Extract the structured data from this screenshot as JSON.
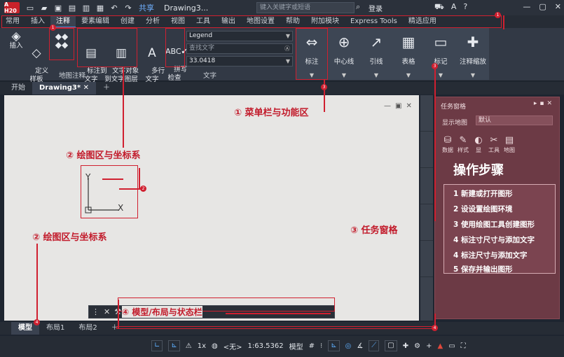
{
  "titlebar": {
    "logo": "A H20",
    "share": "共享",
    "doc_title": "Drawing3...",
    "search_placeholder": "键入关键字或短语",
    "login": "登录"
  },
  "menu_tabs": [
    "常用",
    "插入",
    "注释",
    "要素编辑",
    "创建",
    "分析",
    "视图",
    "工具",
    "输出",
    "地图设置",
    "帮助",
    "附加模块",
    "Express Tools",
    "精选应用"
  ],
  "active_menu_tab": "注释",
  "ribbon": {
    "insert_label": "插入",
    "define_label": "定义\n样板",
    "label_to_text": "标注到\n文字",
    "text_obj_label": "文字对象\n到文字图层",
    "map_annot_panel": "地图注释",
    "multiline_text": "多行\n文字",
    "spell_check": "拼写\n检查",
    "style_dropdown": "Legend",
    "find_text": "查找文字",
    "height_value": "33.0418",
    "text_panel": "文字",
    "dim_label": "标注",
    "centerline_label": "中心线",
    "leader_label": "引线",
    "table_label": "表格",
    "mark_label": "标记",
    "annot_scale_label": "注释缩放"
  },
  "doc_tabs": [
    "开始",
    "Drawing3*"
  ],
  "active_doc_tab": "Drawing3*",
  "canvas": {
    "axis_y": "Y",
    "axis_x": "X"
  },
  "task_pane": {
    "title": "任务窗格",
    "show_map_label": "显示地图",
    "show_map_value": "默认",
    "icons": [
      {
        "label": "数据",
        "icon": "database-icon"
      },
      {
        "label": "样式",
        "icon": "brush-icon"
      },
      {
        "label": "显",
        "icon": "display-icon"
      },
      {
        "label": "工具",
        "icon": "tools-icon"
      },
      {
        "label": "地图",
        "icon": "map-icon"
      }
    ],
    "steps_title": "操作步骤",
    "steps": [
      "1 新建或打开图形",
      "2 设设置绘图环境",
      "3 使用绘图工具创建图形",
      "4 标注寸尺寸与添加文字",
      "4 标注尺寸与添加文字",
      "5 保存并输出图形"
    ]
  },
  "layout_tabs": [
    "模型",
    "布局1",
    "布局2"
  ],
  "active_layout_tab": "模型",
  "statusbar": {
    "scale": "1x",
    "none_label": "<无>",
    "scale_ratio": "1:63.5362",
    "model_label": "模型"
  },
  "annotations": {
    "a1": "① 菜单栏与功能区",
    "a2a": "② 绘图区与坐标系",
    "a2b": "② 绘图区与坐标系",
    "a3": "③ 任务窗格",
    "a4": "④ 模型/布局与状态栏",
    "badge1": "1",
    "badge2": "2",
    "badge3": "3",
    "badge4": "4"
  }
}
